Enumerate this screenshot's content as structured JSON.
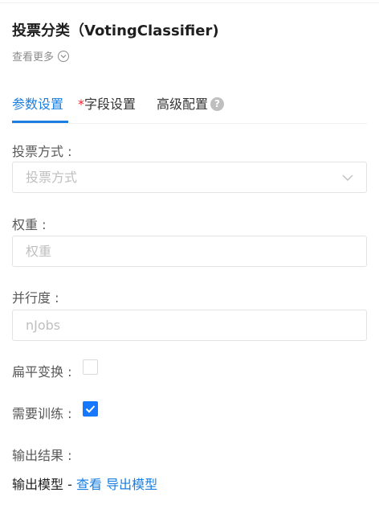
{
  "panel": {
    "title": "投票分类（VotingClassifier)",
    "more_label": "查看更多"
  },
  "tabs": [
    {
      "label": "参数设置",
      "required": false,
      "active": true
    },
    {
      "label": "字段设置",
      "required": true,
      "active": false
    },
    {
      "label": "高级配置",
      "required": false,
      "active": false
    }
  ],
  "form": {
    "voting_method": {
      "label": "投票方式 :",
      "placeholder": "投票方式"
    },
    "weights": {
      "label": "权重 :",
      "placeholder": "权重"
    },
    "parallelism": {
      "label": "并行度 :",
      "placeholder": "nJobs"
    },
    "flatten": {
      "label": "扁平变换 :",
      "checked": false
    },
    "need_training": {
      "label": "需要训练 :",
      "checked": true
    },
    "output": {
      "label": "输出结果 :",
      "model_text": "输出模型 - ",
      "view_link": "查看",
      "export_link": "导出模型"
    }
  },
  "colors": {
    "accent": "#1a7fe0",
    "checkbox_checked": "#1677ff",
    "required_star": "#f5222d"
  }
}
